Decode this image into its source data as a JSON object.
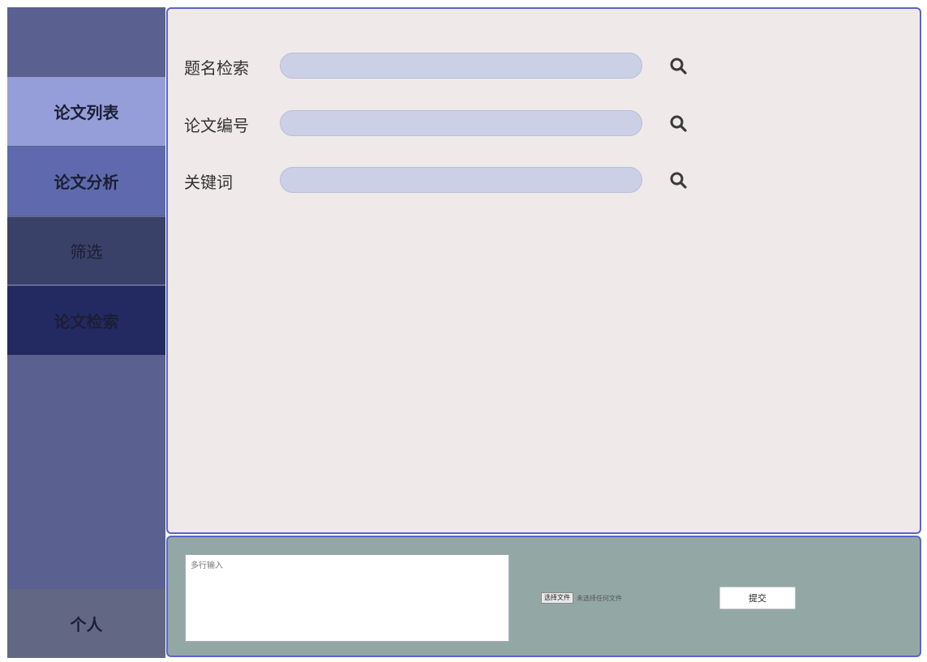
{
  "sidebar": {
    "items": [
      {
        "label": "论文列表"
      },
      {
        "label": "论文分析"
      },
      {
        "label": "筛选"
      },
      {
        "label": "论文检索"
      }
    ],
    "profile_label": "个人"
  },
  "search": {
    "fields": [
      {
        "label": "题名检索",
        "value": "",
        "icon": "search-icon"
      },
      {
        "label": "论文编号",
        "value": "",
        "icon": "search-icon"
      },
      {
        "label": "关键词",
        "value": "",
        "icon": "search-icon"
      }
    ]
  },
  "upload": {
    "textarea_placeholder": "多行输入",
    "file_button_label": "选择文件",
    "file_status": "未选择任何文件",
    "submit_label": "提交"
  },
  "colors": {
    "sidebar_bg": "#5a6090",
    "main_bg": "#efe9e9",
    "bottom_bg": "#93a8a5",
    "border_accent": "#5a64c8"
  }
}
